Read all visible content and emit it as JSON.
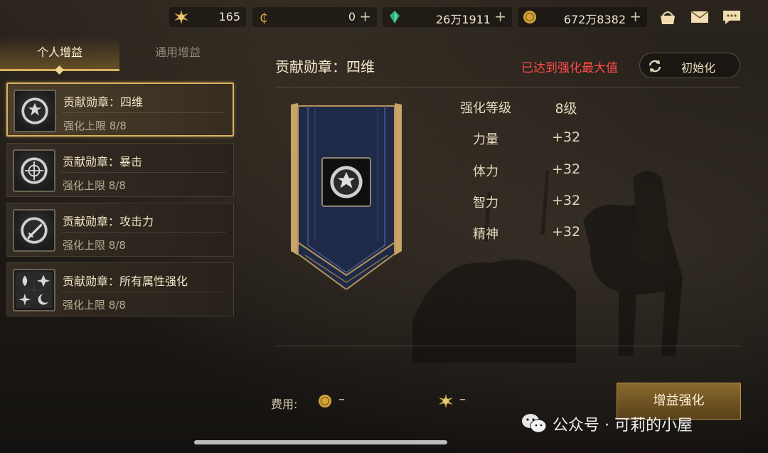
{
  "currencies": [
    {
      "icon": "sun-medal-icon",
      "value": "165",
      "has_plus": false
    },
    {
      "icon": "gold-c-coin-icon",
      "value": "0",
      "has_plus": true
    },
    {
      "icon": "green-crystal-icon",
      "value": "26万1911",
      "has_plus": true
    },
    {
      "icon": "gold-coin-icon",
      "value": "672万8382",
      "has_plus": true
    }
  ],
  "top_icons": [
    "shop-icon",
    "mail-icon",
    "chat-icon"
  ],
  "tabs": [
    {
      "label": "个人增益",
      "active": true
    },
    {
      "label": "通用增益",
      "active": false
    }
  ],
  "medals": [
    {
      "name": "贡献勋章：四维",
      "limit": "强化上限 8/8",
      "selected": true
    },
    {
      "name": "贡献勋章：暴击",
      "limit": "强化上限 8/8",
      "selected": false
    },
    {
      "name": "贡献勋章：攻击力",
      "limit": "强化上限 8/8",
      "selected": false
    },
    {
      "name": "贡献勋章：所有属性强化",
      "limit": "强化上限 8/8",
      "selected": false
    }
  ],
  "detail": {
    "title": "贡献勋章：四维",
    "max_notice": "已达到强化最大值",
    "reset_label": "初始化",
    "stats": [
      {
        "label": "强化等级",
        "value": "8级"
      },
      {
        "label": "力量",
        "value": "+32"
      },
      {
        "label": "体力",
        "value": "+32"
      },
      {
        "label": "智力",
        "value": "+32"
      },
      {
        "label": "精神",
        "value": "+32"
      }
    ]
  },
  "cost": {
    "label": "费用:",
    "gold": "–",
    "medal": "–"
  },
  "action_label": "增益强化",
  "watermark": "公众号 · 可莉的小屋",
  "colors": {
    "accent": "#d9b35e",
    "warning": "#ff4a4a",
    "button": "#7a5c26"
  }
}
